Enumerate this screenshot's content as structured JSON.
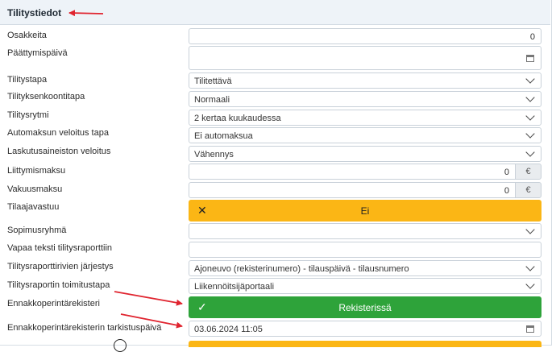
{
  "section": {
    "title": "Tilitystiedot"
  },
  "fields": {
    "osakkeita": {
      "label": "Osakkeita",
      "value": "0"
    },
    "paattymispaiva": {
      "label": "Päättymispäivä",
      "value": ""
    },
    "tilitystapa": {
      "label": "Tilitystapa",
      "value": "Tilitettävä"
    },
    "tilityksenkoontitapa": {
      "label": "Tilityksenkoontitapa",
      "value": "Normaali"
    },
    "tilitysrytmi": {
      "label": "Tilitysrytmi",
      "value": "2 kertaa kuukaudessa"
    },
    "automaksun_veloitus_tapa": {
      "label": "Automaksun veloitus tapa",
      "value": "Ei automaksua"
    },
    "laskutusaineiston_veloitus": {
      "label": "Laskutusaineiston veloitus",
      "value": "Vähennys"
    },
    "liittymismaksu": {
      "label": "Liittymismaksu",
      "value": "0",
      "unit": "€"
    },
    "vakuusmaksu": {
      "label": "Vakuusmaksu",
      "value": "0",
      "unit": "€"
    },
    "tilaajavastuu": {
      "label": "Tilaajavastuu",
      "button_label": "Ei"
    },
    "sopimusryhma": {
      "label": "Sopimusryhmä",
      "value": ""
    },
    "vapaa_teksti": {
      "label": "Vapaa teksti tilitysraporttiin",
      "value": ""
    },
    "rivien_jarjestys": {
      "label": "Tilitysraporttirivien järjestys",
      "value": "Ajoneuvo (rekisterinumero) - tilauspäivä - tilausnumero"
    },
    "toimitustapa": {
      "label": "Tilitysraportin toimitustapa",
      "value": "Liikennöitsijäportaali"
    },
    "ennakkoperintarekisteri": {
      "label": "Ennakkoperintärekisteri",
      "button_label": "Rekisterissä"
    },
    "tarkistuspaiva": {
      "label": "Ennakkoperintärekisterin tarkistuspäivä",
      "value": "03.06.2024 11:05"
    }
  },
  "colors": {
    "warning": "#fbb615",
    "success": "#2ea33a",
    "annotation": "#e0242f"
  }
}
